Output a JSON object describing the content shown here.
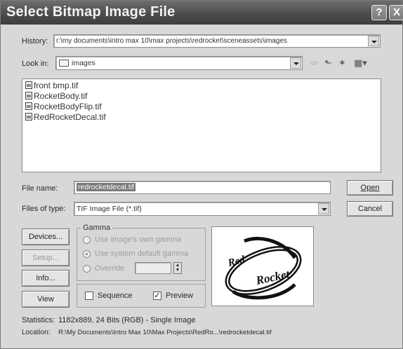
{
  "window": {
    "title": "Select Bitmap Image File",
    "help_glyph": "?",
    "close_glyph": "X"
  },
  "history": {
    "label": "History:",
    "value": "r:\\my documents\\intro max 10\\max projects\\redrocket\\sceneassets\\images"
  },
  "lookin": {
    "label": "Look in:",
    "value": "images"
  },
  "files": [
    {
      "name": "front bmp.tif"
    },
    {
      "name": "RocketBody.tif"
    },
    {
      "name": "RocketBodyFlip.tif"
    },
    {
      "name": "RedRocketDecal.tif"
    }
  ],
  "filename": {
    "label": "File name:",
    "value": "redrocketdecal.tif"
  },
  "filetype": {
    "label": "Files of type:",
    "value": "TIF Image File (*.tif)"
  },
  "buttons": {
    "open": "Open",
    "cancel": "Cancel",
    "devices": "Devices...",
    "setup": "Setup...",
    "info": "Info...",
    "view": "View"
  },
  "gamma": {
    "title": "Gamma",
    "option_own": "Use image's own gamma",
    "option_system": "Use system default gamma",
    "option_override": "Override",
    "selected": "system"
  },
  "sequence": {
    "label": "Sequence",
    "checked": false
  },
  "preview_opt": {
    "label": "Preview",
    "checked": true
  },
  "preview_image": {
    "word1": "Red",
    "word2": "Rocket"
  },
  "statistics": {
    "label": "Statistics:",
    "value": "1182x889, 24 Bits (RGB) - Single Image"
  },
  "location": {
    "label": "Location:",
    "value": "R:\\My Documents\\Intro Max 10\\Max Projects\\RedRo...\\redrocketdecal.tif"
  }
}
